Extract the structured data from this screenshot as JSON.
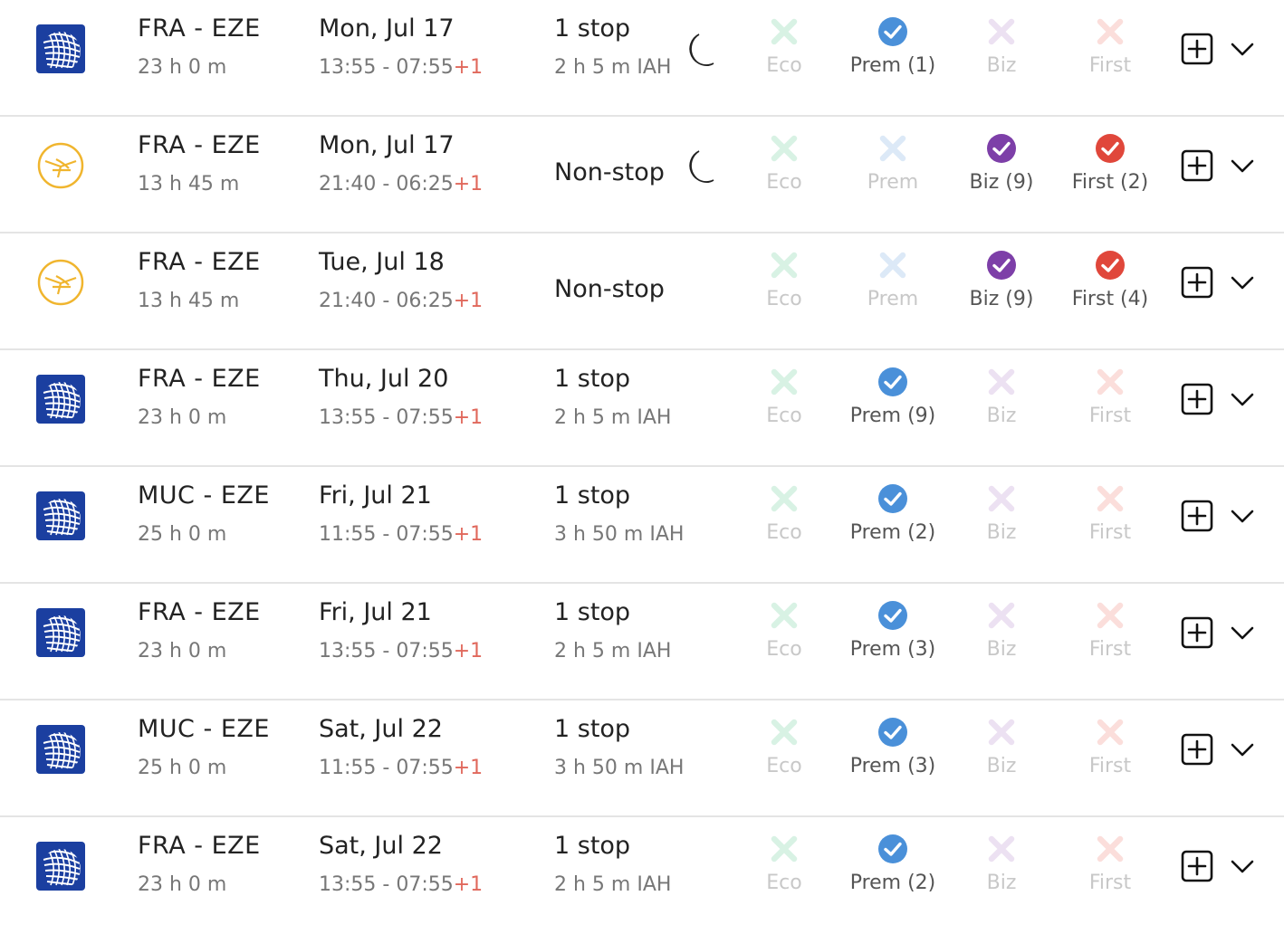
{
  "colors": {
    "united_blue": "#1b3fa0",
    "lufthansa_gold": "#f0b52e",
    "prem_blue": "#4a90d9",
    "biz_purple": "#7d3fa8",
    "first_red": "#e0473b",
    "eco_na": "#d8f2e4",
    "prem_na": "#dce9f7",
    "biz_na": "#ece1f2",
    "first_na": "#fbdedb",
    "day_plus": "#e0685c"
  },
  "flights": [
    {
      "airline_logo": "united-globe-icon",
      "route": "FRA - EZE",
      "duration": "23 h 0 m",
      "date": "Mon, Jul 17",
      "times": "13:55 - 07:55",
      "day_offset": "+1",
      "stops": "1 stop",
      "layover": "2 h 5 m  IAH",
      "overnight": true,
      "eco": "Eco",
      "eco_available": false,
      "prem": "Prem (1)",
      "prem_available": true,
      "biz": "Biz",
      "biz_available": false,
      "first": "First",
      "first_available": false
    },
    {
      "airline_logo": "lufthansa-crane-icon",
      "route": "FRA - EZE",
      "duration": "13 h 45 m",
      "date": "Mon, Jul 17",
      "times": "21:40 - 06:25",
      "day_offset": "+1",
      "stops": "Non-stop",
      "layover": "",
      "overnight": true,
      "eco": "Eco",
      "eco_available": false,
      "prem": "Prem",
      "prem_available": false,
      "biz": "Biz (9)",
      "biz_available": true,
      "first": "First (2)",
      "first_available": true
    },
    {
      "airline_logo": "lufthansa-crane-icon",
      "route": "FRA - EZE",
      "duration": "13 h 45 m",
      "date": "Tue, Jul 18",
      "times": "21:40 - 06:25",
      "day_offset": "+1",
      "stops": "Non-stop",
      "layover": "",
      "overnight": false,
      "eco": "Eco",
      "eco_available": false,
      "prem": "Prem",
      "prem_available": false,
      "biz": "Biz (9)",
      "biz_available": true,
      "first": "First (4)",
      "first_available": true
    },
    {
      "airline_logo": "united-globe-icon",
      "route": "FRA - EZE",
      "duration": "23 h 0 m",
      "date": "Thu, Jul 20",
      "times": "13:55 - 07:55",
      "day_offset": "+1",
      "stops": "1 stop",
      "layover": "2 h 5 m  IAH",
      "overnight": false,
      "eco": "Eco",
      "eco_available": false,
      "prem": "Prem (9)",
      "prem_available": true,
      "biz": "Biz",
      "biz_available": false,
      "first": "First",
      "first_available": false
    },
    {
      "airline_logo": "united-globe-icon",
      "route": "MUC - EZE",
      "duration": "25 h 0 m",
      "date": "Fri, Jul 21",
      "times": "11:55 - 07:55",
      "day_offset": "+1",
      "stops": "1 stop",
      "layover": "3 h 50 m  IAH",
      "overnight": false,
      "eco": "Eco",
      "eco_available": false,
      "prem": "Prem (2)",
      "prem_available": true,
      "biz": "Biz",
      "biz_available": false,
      "first": "First",
      "first_available": false
    },
    {
      "airline_logo": "united-globe-icon",
      "route": "FRA - EZE",
      "duration": "23 h 0 m",
      "date": "Fri, Jul 21",
      "times": "13:55 - 07:55",
      "day_offset": "+1",
      "stops": "1 stop",
      "layover": "2 h 5 m  IAH",
      "overnight": false,
      "eco": "Eco",
      "eco_available": false,
      "prem": "Prem (3)",
      "prem_available": true,
      "biz": "Biz",
      "biz_available": false,
      "first": "First",
      "first_available": false
    },
    {
      "airline_logo": "united-globe-icon",
      "route": "MUC - EZE",
      "duration": "25 h 0 m",
      "date": "Sat, Jul 22",
      "times": "11:55 - 07:55",
      "day_offset": "+1",
      "stops": "1 stop",
      "layover": "3 h 50 m  IAH",
      "overnight": false,
      "eco": "Eco",
      "eco_available": false,
      "prem": "Prem (3)",
      "prem_available": true,
      "biz": "Biz",
      "biz_available": false,
      "first": "First",
      "first_available": false
    },
    {
      "airline_logo": "united-globe-icon",
      "route": "FRA - EZE",
      "duration": "23 h 0 m",
      "date": "Sat, Jul 22",
      "times": "13:55 - 07:55",
      "day_offset": "+1",
      "stops": "1 stop",
      "layover": "2 h 5 m  IAH",
      "overnight": false,
      "eco": "Eco",
      "eco_available": false,
      "prem": "Prem (2)",
      "prem_available": true,
      "biz": "Biz",
      "biz_available": false,
      "first": "First",
      "first_available": false
    }
  ]
}
